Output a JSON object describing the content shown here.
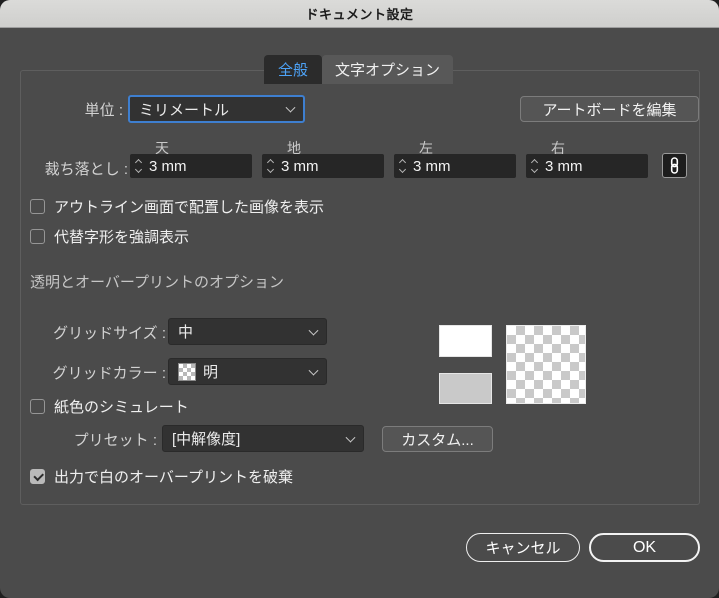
{
  "window": {
    "title": "ドキュメント設定"
  },
  "tabs": [
    {
      "label": "全般",
      "active": true
    },
    {
      "label": "文字オプション",
      "active": false
    }
  ],
  "general": {
    "units_label": "単位 :",
    "units_value": "ミリメートル",
    "edit_artboards_button": "アートボードを編集",
    "bleed": {
      "label": "裁ち落とし :",
      "fields": [
        {
          "label": "天",
          "value": "3 mm"
        },
        {
          "label": "地",
          "value": "3 mm"
        },
        {
          "label": "左",
          "value": "3 mm"
        },
        {
          "label": "右",
          "value": "3 mm"
        }
      ],
      "link_icon": "chain-link",
      "linked": true
    },
    "show_images_in_outline": {
      "label": "アウトライン画面で配置した画像を表示",
      "checked": false
    },
    "highlight_substituted_glyphs": {
      "label": "代替字形を強調表示",
      "checked": false
    }
  },
  "transparency": {
    "section_title": "透明とオーバープリントのオプション",
    "grid_size_label": "グリッドサイズ :",
    "grid_size_value": "中",
    "grid_color_label": "グリッドカラー :",
    "grid_color_value": "明",
    "grid_color_swatch_icon": "checkerboard-icon",
    "simulate_paper": {
      "label": "紙色のシミュレート",
      "checked": false
    },
    "preset_label": "プリセット :",
    "preset_value": "[中解像度]",
    "custom_button": "カスタム...",
    "discard_white_overprint": {
      "label": "出力で白のオーバープリントを破棄",
      "checked": true
    }
  },
  "footer": {
    "cancel_button": "キャンセル",
    "ok_button": "OK"
  },
  "colors": {
    "accent_blue": "#4da3f8",
    "focus_border": "#3e7fd0",
    "dialog_bg": "#4b4b4b",
    "titlebar_bg": "#d5d5d3",
    "field_bg": "#262626",
    "checker_gray": "#c9c9c9"
  }
}
